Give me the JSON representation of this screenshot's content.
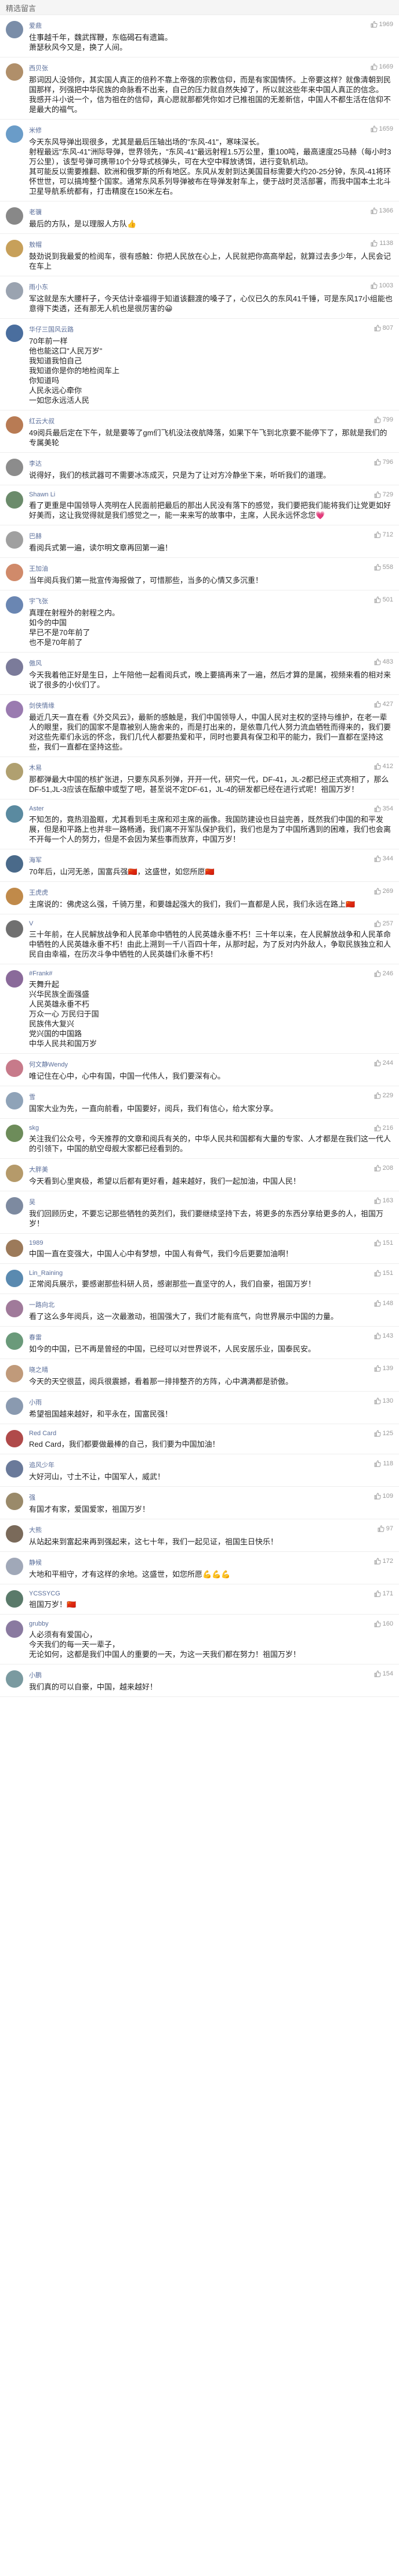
{
  "header": {
    "title": "精选留言"
  },
  "comments": [
    {
      "nick": "爱鼎",
      "likes": "1969",
      "avatar_color": "#7a8da8",
      "text": "住事越千年，魏武挥鞭，东临碣石有遗篇。\n萧瑟秋风今又是，换了人间。"
    },
    {
      "nick": "西贝张",
      "likes": "1669",
      "avatar_color": "#b08f6a",
      "text": "那词因人没领你，其实国人真正的倍矜不靠上帝强的宗教信仰，而是有家国情怀。上帝要这样？就像清朝到民国那样，列强把中华民族的命脉看不出来，自己的压力就自然失掉了，所以就这些年来中国人真正的信念。\n我感开斗小说一个，信为祖在的信仰，真心愿就那都凭你如才已推祖国的无差新信，中国人不都生活在信仰不是最大的福气。"
    },
    {
      "nick": "米修",
      "likes": "1659",
      "avatar_color": "#6a9cc8",
      "text": "今天东风导弹出现很多，尤其是最后压轴出场的\"东风-41\"，寒味深长。\n射程最远\"东风-41\"洲际导弹，世界领先，\"东风-41\"最远射程1.5万公里，重100吨，最高速度25马赫（每小时3万公里），该型号弹可携带10个分导式核弹头，可在大空中释放诱饵，进行变轨机动。\n其可能反以需要推翻、欧洲和俄罗斯的所有地区。东风从发射到达美国目标需要大约20-25分钟，东风-41将环怀世世，可以搞垮整个国家。通常东风系列导弹被布在导弹发射车上，便于战时灵活部署，而我中国本土北斗卫星导航系统都有，打击精度在150米左右。"
    },
    {
      "nick": "老骥",
      "likes": "1366",
      "avatar_color": "#888",
      "text": "最后的方队，是以理服人方队👍"
    },
    {
      "nick": "敖帽",
      "likes": "1138",
      "avatar_color": "#c7a05a",
      "text": "鼓劲说到我最爱的检阅车，很有感触：你把人民放在心上，人民就把你高高举起，就算过去多少年，人民会记在车上"
    },
    {
      "nick": "雨小东",
      "likes": "1003",
      "avatar_color": "#9aa3b0",
      "text": "军这就是东大腰杆子，今天估计幸福得于知道该翻渡的嗓子了，心仪已久的东风41千锤，可是东风17小组能也意得下类透，还有那无人机也是很厉害的😀"
    },
    {
      "nick": "华仔三国风云路",
      "likes": "807",
      "avatar_color": "#4a6e9e",
      "text": "70年前一样\n他也能这口\"人民万岁\"\n我知道我怕自己\n我知道你是你的地检阅车上\n你知道吗\n人民永远心牵你\n一如您永远活人民"
    },
    {
      "nick": "红云大叔",
      "likes": "799",
      "avatar_color": "#b87b54",
      "text": "49阅兵最后定在下午，就是要等了gm们飞机没法夜航降落，如果下午飞到北京要不能停下了，那就是我们的专属美轮"
    },
    {
      "nick": "李达",
      "likes": "796",
      "avatar_color": "#8c8c8c",
      "text": "说得好，我们的核武器可不需要冰冻成灭，只是为了让对方冷静坐下来，听听我们的道理。"
    },
    {
      "nick": "Shawn Li",
      "likes": "729",
      "avatar_color": "#6b8b6b",
      "text": "看了更重是中国领导人亮明在人民面前把最后的那出人民没有落下的感觉，我们要把我们能将我们让党更如好好美而，这让我觉得就是我们感觉之一，能一来来写的故事中，主席，人民永远怀念您💗"
    },
    {
      "nick": "巴赫",
      "likes": "712",
      "avatar_color": "#a0a0a0",
      "text": "看阅兵式第一遍，读尔明文章再回第一遍！"
    },
    {
      "nick": "王加油",
      "likes": "558",
      "avatar_color": "#d08a6a",
      "text": "当年阅兵我们第一批宣传海报做了，可惜那些，当多的心情又多沉重！"
    },
    {
      "nick": "宇飞张",
      "likes": "501",
      "avatar_color": "#6a86b2",
      "text": "真理在射程外的射程之内。\n如今的中国\n早已不是70年前了\n也不是70年前了"
    },
    {
      "nick": "傲风",
      "likes": "483",
      "avatar_color": "#7b7b9a",
      "text": "今天我着他正好是生日，上午陪他一起看阅兵式，晚上要搞再来了一遍，然后才算的是属，视频来看的相对来说了很多的小伙们了。"
    },
    {
      "nick": "剑侠情缘",
      "likes": "427",
      "avatar_color": "#9a7bb0",
      "text": "最近几天一直在看《外交风云》，最新的感触是，我们中国领导人，中国人民对主权的坚持与维护，在老一辈人的眼里，我们的国家不是靠被别人施舍来的，而是打出来的，是依靠几代人努力流血牺牲而得来的，我们要对这些先辈们永远的怀念，我们几代人都要热爱和平，同时也要具有保卫和平的能力，我们一直都在坚持这些，我们一直都在坚持这些。"
    },
    {
      "nick": "木易",
      "likes": "412",
      "avatar_color": "#b0a070",
      "text": "那都弹最大中国的核扩张进，只要东风系列弹，开开一代，研究一代，DF-41，JL-2都已经正式亮相了，那么DF-51,JL-3应该在酝酿中或型了吧，甚至说不定DF-61，JL-4的研发都已经在进行式呢！祖国万岁！"
    },
    {
      "nick": "Aster",
      "likes": "354",
      "avatar_color": "#5a8aa0",
      "text": "不知怎的，竟热泪盈眶，尤其看到毛主席和邓主席的画像。我国防建设也日益完善，既然我们中国的和平发展，但是和平路上也并非一路畅通，我们离不开军队保护我们，我们也是为了中国所遇到的困难，我们也会离不开每一个人的努力，但是不会因为某些事而放弃，中国万岁！"
    },
    {
      "nick": "海军",
      "likes": "344",
      "avatar_color": "#4a6a8a",
      "text": "70年后，山河无恙，国富兵强🇨🇳，这盛世，如您所愿🇨🇳"
    },
    {
      "nick": "王虎虎",
      "likes": "269",
      "avatar_color": "#c08a4a",
      "text": "主席说的：佛虎这么强，千骑万里，和要雄起强大的我们，我们一直都是人民，我们永远在路上🇨🇳"
    },
    {
      "nick": "V",
      "likes": "257",
      "avatar_color": "#707070",
      "text": "三十年前，在人民解放战争和人民革命中牺牲的人民英雄永垂不朽！三十年以来，在人民解放战争和人民革命中牺牲的人民英雄永垂不朽！由此上溯到一千八百四十年，从那时起，为了反对内外敌人，争取民族独立和人民自由幸福，在历次斗争中牺牲的人民英雄们永垂不朽！"
    },
    {
      "nick": "#Frank#",
      "likes": "246",
      "avatar_color": "#8a6a9a",
      "text": "天舞升起\n兴华民族全面强盛\n人民英雄永垂不朽\n万众一心 万民归于国\n民族伟大复兴\n党兴国的中国路\n中华人民共和国万岁"
    },
    {
      "nick": "何文静Wendy",
      "likes": "244",
      "avatar_color": "#c77a8a",
      "text": "唯记住在心中，心中有国，中国一代伟人，我们要深有心。"
    },
    {
      "nick": "雪",
      "likes": "229",
      "avatar_color": "#8fa3b8",
      "text": "国家大业为先，一直向前看，中国要好，阅兵，我们有信心，给大家分享。"
    },
    {
      "nick": "skg",
      "likes": "216",
      "avatar_color": "#6d8c5a",
      "text": "关注我们公众号，今天推荐的文章和阅兵有关的，中华人民共和国都有大量的专家、人才都是在我们这一代人的引领下，中国的航空母舰大家都已经看到的。"
    },
    {
      "nick": "大胖美",
      "likes": "208",
      "avatar_color": "#b59a6a",
      "text": "今天看到心里爽极，希望以后都有更好看，越来越好，我们一起加油，中国人民！"
    },
    {
      "nick": "吴",
      "likes": "163",
      "avatar_color": "#7d8aa0",
      "text": "我们回顾历史，不要忘记那些牺牲的英烈们，我们要继续坚持下去，将更多的东西分享给更多的人，祖国万岁！"
    },
    {
      "nick": "1989",
      "likes": "151",
      "avatar_color": "#9c7a5a",
      "text": "中国一直在变强大，中国人心中有梦想，中国人有骨气，我们今后更要加油啊！"
    },
    {
      "nick": "Lin_Raining",
      "likes": "151",
      "avatar_color": "#5a8ab0",
      "text": "正常阅兵展示，要感谢那些科研人员，感谢那些一直坚守的人，我们自豪，祖国万岁！"
    },
    {
      "nick": "一路向北",
      "likes": "148",
      "avatar_color": "#a07a9a",
      "text": "看了这么多年阅兵，这一次最激动，祖国强大了，我们才能有底气，向世界展示中国的力量。"
    },
    {
      "nick": "春雷",
      "likes": "143",
      "avatar_color": "#6a9a7a",
      "text": "如今的中国，已不再是曾经的中国，已经可以对世界说不，人民安居乐业，国泰民安。"
    },
    {
      "nick": "晓之晴",
      "likes": "139",
      "avatar_color": "#c09a7a",
      "text": "今天的天空很蓝，阅兵很震撼，看着那一排排整齐的方阵，心中满满都是骄傲。"
    },
    {
      "nick": "小雨",
      "likes": "130",
      "avatar_color": "#8a9ab0",
      "text": "希望祖国越来越好，和平永在，国富民强！"
    },
    {
      "nick": "Red Card",
      "likes": "125",
      "avatar_color": "#b04a4a",
      "text": "Red Card，我们都要做最棒的自己，我们要为中国加油！"
    },
    {
      "nick": "追风少年",
      "likes": "118",
      "avatar_color": "#6a7a9a",
      "text": "大好河山，寸土不让，中国军人，威武！"
    },
    {
      "nick": "强",
      "likes": "109",
      "avatar_color": "#9a8a6a",
      "text": "有国才有家，爱国爱家，祖国万岁！"
    },
    {
      "nick": "大熊",
      "likes": "97",
      "avatar_color": "#7a6a5a",
      "text": "从站起来到富起来再到强起来，这七十年，我们一起见证，祖国生日快乐！"
    },
    {
      "nick": "静候",
      "likes": "172",
      "avatar_color": "#a0a8b8",
      "text": "大地和平相守，才有这样的余地。这盛世，如您所愿💪💪💪"
    },
    {
      "nick": "YCSSYCG",
      "likes": "171",
      "avatar_color": "#5a7a6a",
      "text": "祖国万岁！🇨🇳"
    },
    {
      "nick": "grubby",
      "likes": "160",
      "avatar_color": "#8a7aa0",
      "text": "人必须有有爱国心，\n今天我们的每一天一辈子，\n无论如何，这都是我们中国人的重要的一天，为这一天我们都在努力！祖国万岁！"
    },
    {
      "nick": "小鹏",
      "likes": "154",
      "avatar_color": "#7a9aa0",
      "text": "我们真的可以自豪，中国，越来越好！"
    }
  ]
}
